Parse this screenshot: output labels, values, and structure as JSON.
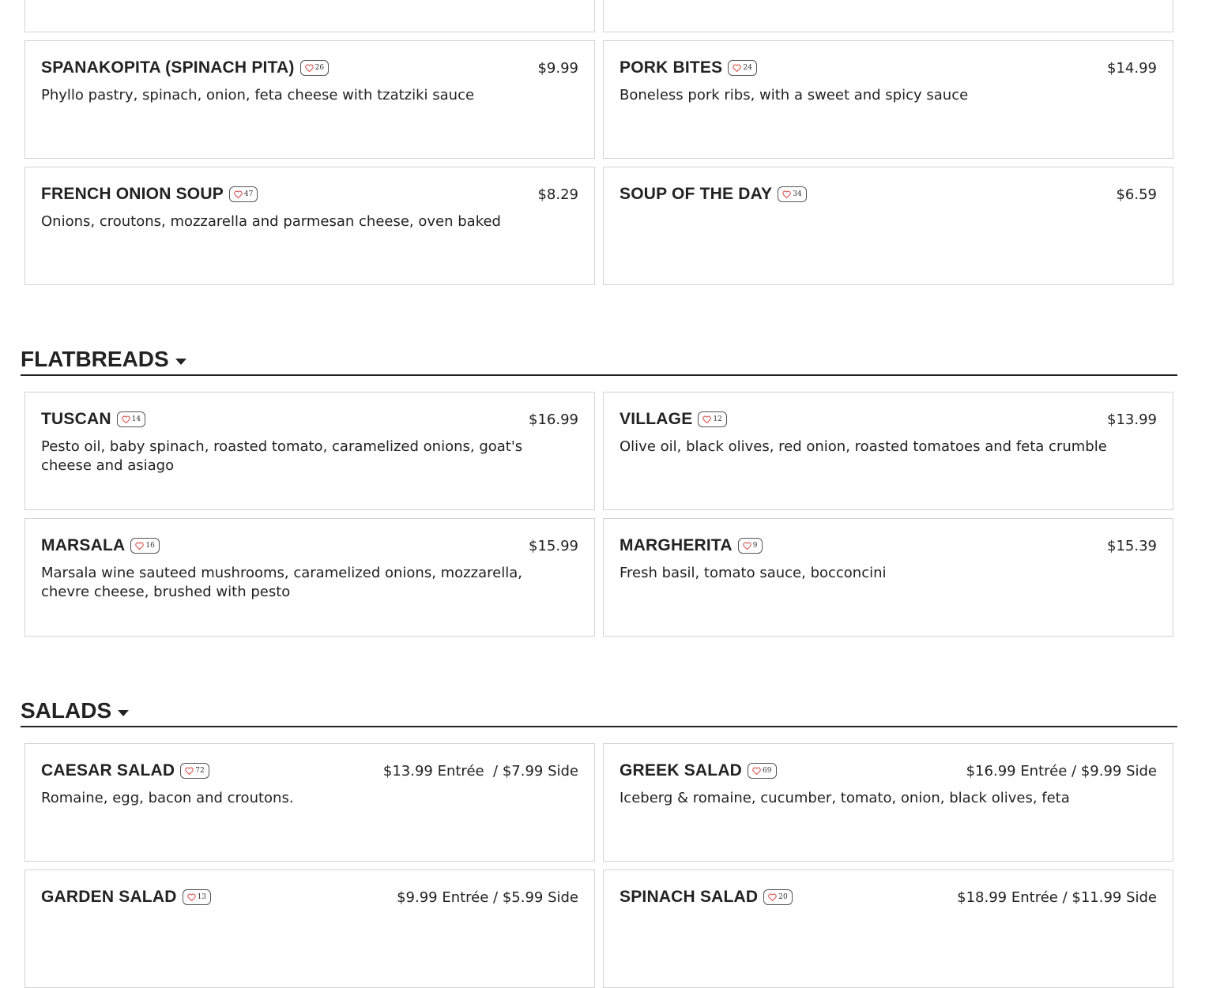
{
  "sections": {
    "flatbreads": {
      "title": "FLATBREADS"
    },
    "salads": {
      "title": "SALADS"
    }
  },
  "items": {
    "spanakopita": {
      "name": "SPANAKOPITA (SPINACH PITA)",
      "likes": "26",
      "price": "$9.99",
      "desc": "Phyllo pastry, spinach, onion, feta cheese with tzatziki sauce"
    },
    "pork_bites": {
      "name": "PORK BITES",
      "likes": "24",
      "price": "$14.99",
      "desc": "Boneless pork ribs, with a sweet and spicy sauce"
    },
    "french_onion": {
      "name": "FRENCH ONION SOUP",
      "likes": "47",
      "price": "$8.29",
      "desc": "Onions, croutons, mozzarella and parmesan cheese, oven baked"
    },
    "soup_day": {
      "name": "SOUP OF THE DAY",
      "likes": "34",
      "price": "$6.59",
      "desc": ""
    },
    "tuscan": {
      "name": "TUSCAN",
      "likes": "14",
      "price": "$16.99",
      "desc": "Pesto oil, baby spinach, roasted tomato, caramelized onions, goat's cheese and asiago"
    },
    "village": {
      "name": "VILLAGE",
      "likes": "12",
      "price": "$13.99",
      "desc": "Olive oil, black olives, red onion, roasted tomatoes and feta crumble"
    },
    "marsala": {
      "name": "MARSALA",
      "likes": "16",
      "price": "$15.99",
      "desc": "Marsala wine sauteed mushrooms, caramelized onions, mozzarella, chevre cheese, brushed with pesto"
    },
    "margherita": {
      "name": "MARGHERITA",
      "likes": "9",
      "price": "$15.39",
      "desc": "Fresh basil, tomato sauce, bocconcini"
    },
    "caesar": {
      "name": "CAESAR SALAD",
      "likes": "72",
      "price": "$13.99 Entrée  / $7.99 Side",
      "desc": "Romaine, egg, bacon and croutons."
    },
    "greek": {
      "name": "GREEK SALAD",
      "likes": "69",
      "price": "$16.99 Entrée / $9.99 Side",
      "desc": "Iceberg & romaine, cucumber, tomato, onion, black olives, feta"
    },
    "garden": {
      "name": "GARDEN SALAD",
      "likes": "13",
      "price": "$9.99 Entrée / $5.99 Side",
      "desc": ""
    },
    "spinach_salad": {
      "name": "SPINACH SALAD",
      "likes": "20",
      "price": "$18.99 Entrée / $11.99 Side",
      "desc": ""
    }
  },
  "icons": {
    "like": "heart-icon",
    "section_toggle": "caret-down-icon"
  },
  "colors": {
    "heart": "#d9534f",
    "text": "#222222",
    "border": "#d3d3d3"
  }
}
